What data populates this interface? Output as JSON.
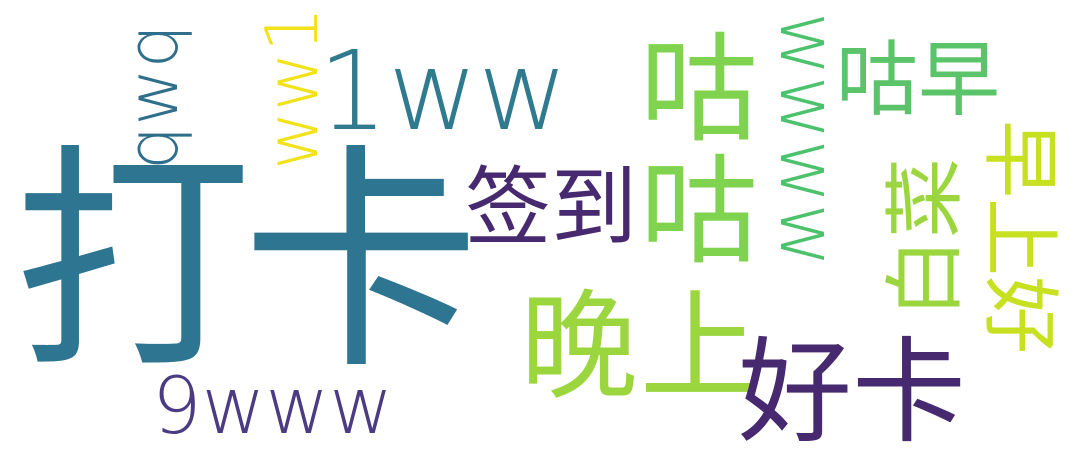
{
  "colors": {
    "background": "#ffffff",
    "teal": "#2e7592",
    "deep_teal": "#2f6f8c",
    "purple": "#47296f",
    "violet": "#4b3b82",
    "yellow": "#f2e21a",
    "lime": "#7fd34e",
    "green": "#4cc26c",
    "mint": "#5bc46b",
    "light_green": "#9cd63f"
  },
  "words": {
    "dak": "打卡",
    "oneww": "1ww",
    "ww1": "ww1",
    "qwq": "qwq",
    "qiandao": "签到",
    "gugu": "咕咕",
    "wwww": "wwww",
    "guzao": "咕早",
    "wanshang": "晚上",
    "haoka": "好卡",
    "ninewww": "9www",
    "baicai": "白菜",
    "zaoshang": "早上好"
  }
}
